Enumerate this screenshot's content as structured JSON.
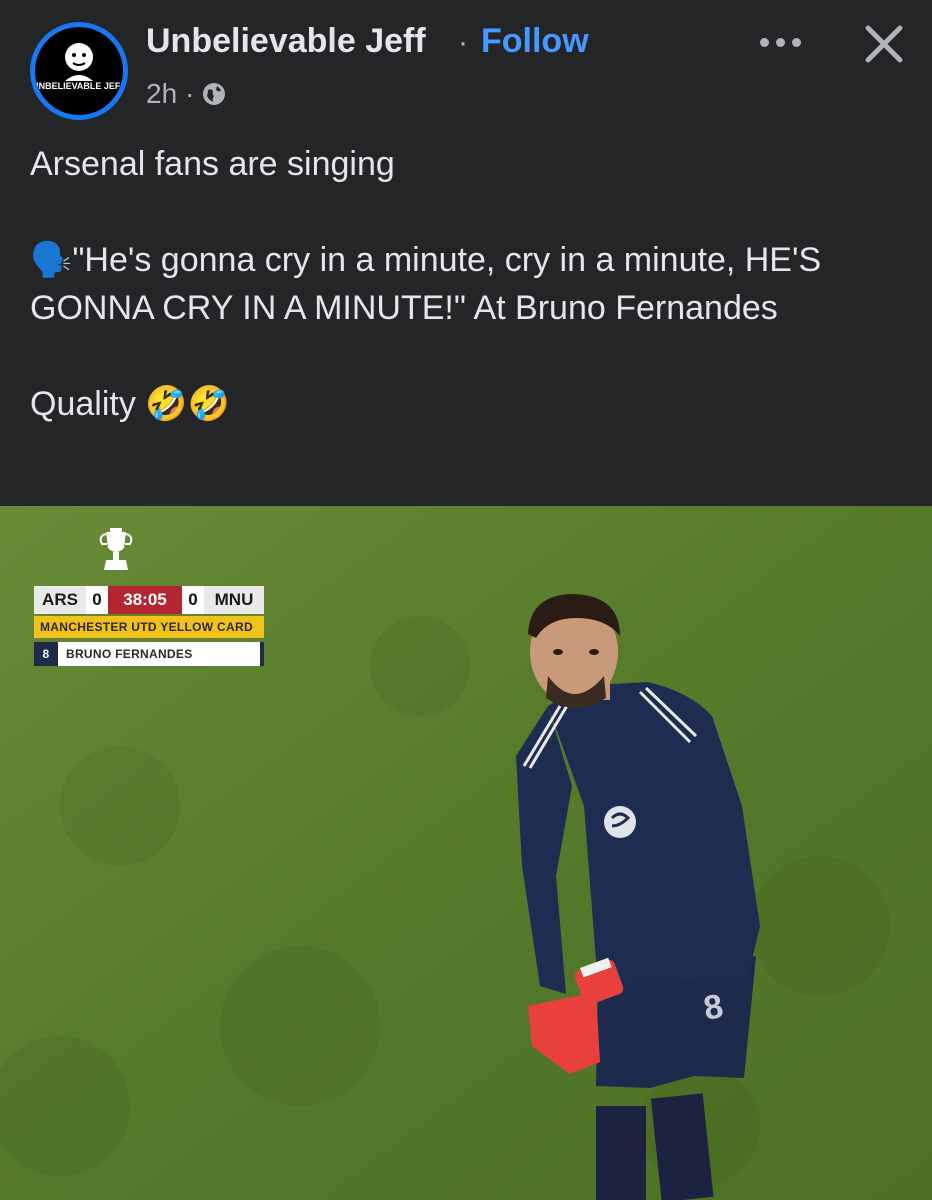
{
  "post": {
    "author": "Unbelievable Jeff",
    "separator": "·",
    "follow_label": "Follow",
    "time": "2h",
    "meta_dot": "·",
    "avatar_text": "UNBELIEVABLE JEFF",
    "icons": {
      "privacy": "globe-icon",
      "more": "more-options-icon",
      "close": "close-icon"
    },
    "text_lines": [
      "Arsenal fans are singing",
      "🗣️\"He's gonna cry in a minute, cry in a minute, HE'S GONNA CRY IN A MINUTE!\" At Bruno Fernandes",
      "Quality 🤣🤣"
    ]
  },
  "scorebug": {
    "home": "ARS",
    "home_score": "0",
    "clock": "38:05",
    "away_score": "0",
    "away": "MNU",
    "event": "MANCHESTER UTD YELLOW CARD",
    "player_number": "8",
    "player_name": "BRUNO FERNANDES"
  },
  "colors": {
    "link": "#4599ff",
    "background": "#242526",
    "clock_red": "#b3262f",
    "card_yellow": "#f2c21b"
  }
}
